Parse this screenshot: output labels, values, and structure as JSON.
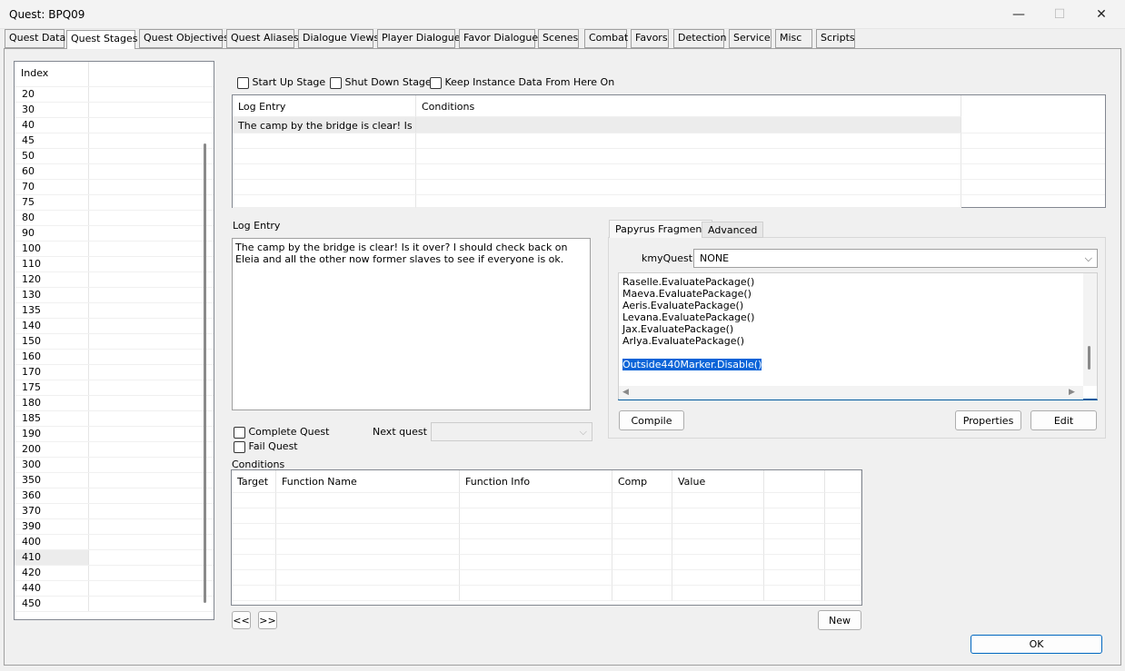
{
  "window": {
    "title": "Quest: BPQ09",
    "minimize_glyph": "—",
    "maximize_glyph": "☐",
    "close_glyph": "✕"
  },
  "tabs": [
    "Quest Data",
    "Quest Stages",
    "Quest Objectives",
    "Quest Aliases",
    "Dialogue Views",
    "Player Dialogue",
    "Favor Dialogue",
    "Scenes",
    "Combat",
    "Favors",
    "Detection",
    "Service",
    "Misc",
    "Scripts"
  ],
  "active_tab": "Quest Stages",
  "stages": {
    "header": "Index",
    "items": [
      "20",
      "30",
      "40",
      "45",
      "50",
      "60",
      "70",
      "75",
      "80",
      "90",
      "100",
      "110",
      "120",
      "130",
      "135",
      "140",
      "150",
      "160",
      "170",
      "175",
      "180",
      "185",
      "190",
      "200",
      "300",
      "350",
      "360",
      "370",
      "390",
      "400",
      "410",
      "420",
      "440",
      "450"
    ],
    "selected": "410"
  },
  "flags": {
    "start_up": "Start Up Stage",
    "shut_down": "Shut Down Stage",
    "keep_instance": "Keep Instance Data From Here On"
  },
  "log_table": {
    "columns": [
      "Log Entry",
      "Conditions"
    ],
    "rows": [
      [
        "The camp by the bridge is clear! Is it o...",
        ""
      ]
    ]
  },
  "log_entry": {
    "label": "Log Entry",
    "text": "The camp by the bridge is clear! Is it over? I should check back on Eleia and all the other now former slaves to see if everyone is ok."
  },
  "quest_options": {
    "complete": "Complete Quest",
    "fail": "Fail Quest",
    "next_quest_label": "Next quest",
    "next_quest_value": ""
  },
  "conditions": {
    "label": "Conditions",
    "columns": [
      "Target",
      "Function Name",
      "Function Info",
      "Comp",
      "Value",
      ""
    ],
    "prev_btn": "<<",
    "next_btn": ">>",
    "new_btn": "New"
  },
  "script_panel": {
    "tabs": [
      "Papyrus Fragment",
      "Advanced"
    ],
    "active_tab": "Papyrus Fragment",
    "kmy_label": "kmyQuest",
    "kmy_value": "NONE",
    "code_lines": [
      "Raselle.EvaluatePackage()",
      "Maeva.EvaluatePackage()",
      "Aeris.EvaluatePackage()",
      "Levana.EvaluatePackage()",
      "Jax.EvaluatePackage()",
      "Arlya.EvaluatePackage()",
      "",
      "Outside440Marker.Disable()"
    ],
    "compile_btn": "Compile",
    "properties_btn": "Properties",
    "edit_btn": "Edit"
  },
  "ok_btn": "OK"
}
